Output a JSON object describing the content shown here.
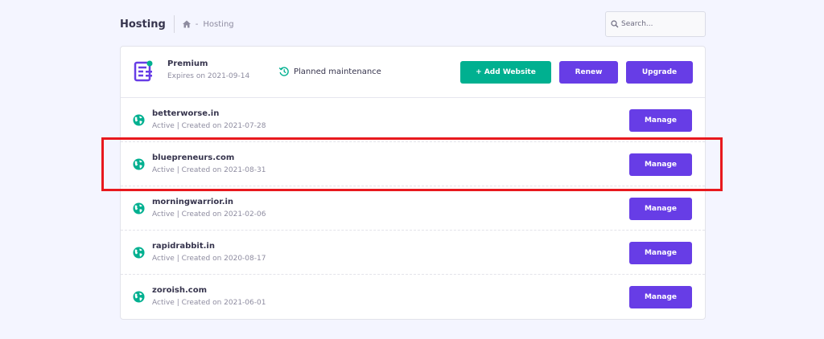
{
  "header": {
    "title": "Hosting",
    "breadcrumb": {
      "home_icon": "home-icon",
      "separator": "-",
      "current": "Hosting"
    },
    "search": {
      "placeholder": "Search..."
    }
  },
  "plan": {
    "icon": "server-icon",
    "name": "Premium",
    "expires": "Expires on 2021-09-14",
    "maintenance_icon": "history-icon",
    "maintenance": "Planned maintenance",
    "add_website_label": "+ Add Website",
    "renew_label": "Renew",
    "upgrade_label": "Upgrade"
  },
  "websites": [
    {
      "domain": "betterworse.in",
      "status": "Active | Created on 2021-07-28",
      "manage_label": "Manage",
      "highlighted": false
    },
    {
      "domain": "bluepreneurs.com",
      "status": "Active | Created on 2021-08-31",
      "manage_label": "Manage",
      "highlighted": true
    },
    {
      "domain": "morningwarrior.in",
      "status": "Active | Created on 2021-02-06",
      "manage_label": "Manage",
      "highlighted": false
    },
    {
      "domain": "rapidrabbit.in",
      "status": "Active | Created on 2020-08-17",
      "manage_label": "Manage",
      "highlighted": false
    },
    {
      "domain": "zoroish.com",
      "status": "Active | Created on 2021-06-01",
      "manage_label": "Manage",
      "highlighted": false
    }
  ],
  "colors": {
    "primary": "#673de6",
    "success": "#00b090",
    "highlight": "#e8191e",
    "background": "#f4f5ff"
  }
}
